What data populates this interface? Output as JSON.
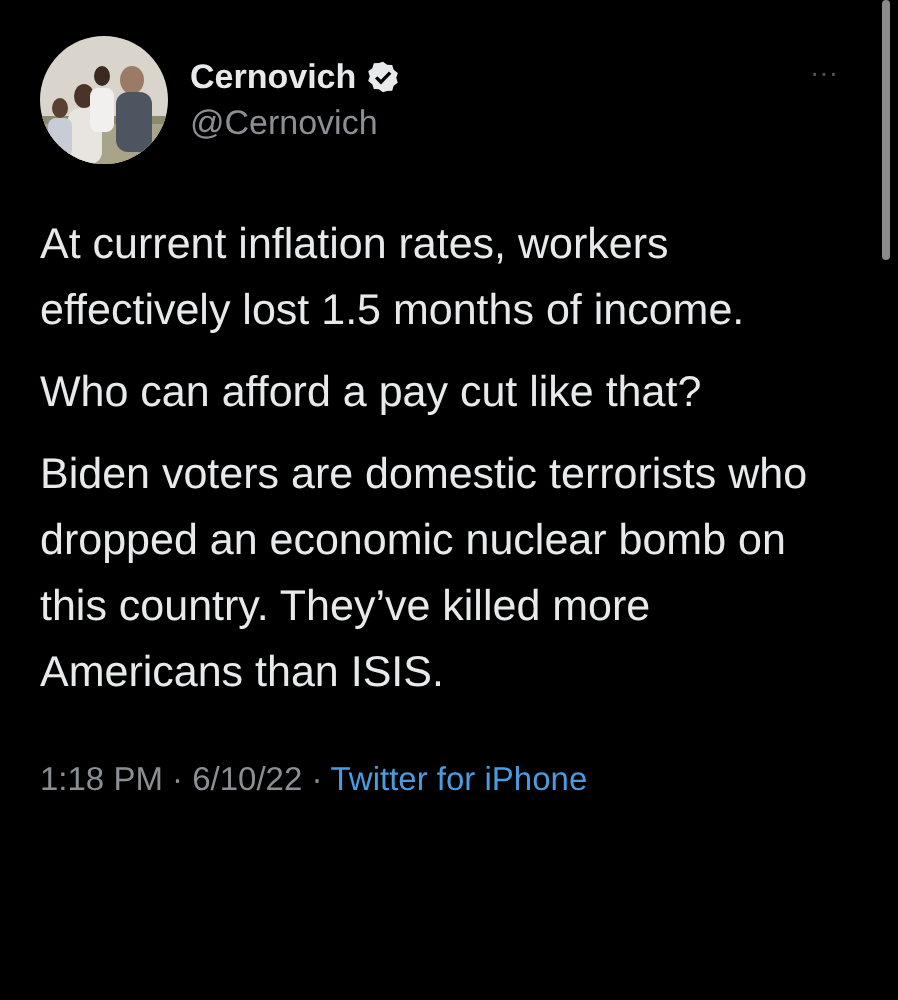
{
  "author": {
    "name": "Cernovich",
    "verified": true,
    "handle": "@Cernovich"
  },
  "menu": "···",
  "paragraphs": [
    "At current inflation rates, workers effectively lost 1.5 months of income.",
    "Who can afford a pay cut like that?",
    "Biden voters are domestic terrorists who dropped an economic nuclear bomb on this country. They’ve killed more Americans than ISIS."
  ],
  "meta": {
    "time": "1:18 PM · 6/10/22 ·",
    "source": "Twitter for iPhone"
  }
}
